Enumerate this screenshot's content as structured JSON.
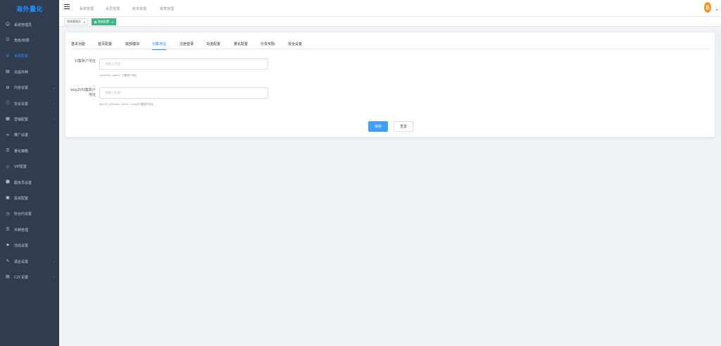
{
  "brand": {
    "title": "海外量化"
  },
  "sidebar": {
    "items": [
      {
        "label": "系统管理员",
        "icon": "user-icon",
        "glyph": "☺",
        "active": false,
        "has_arrow": false
      },
      {
        "label": "角色/权限",
        "icon": "org-chart-icon",
        "glyph": "☷",
        "active": false,
        "has_arrow": false
      },
      {
        "label": "系统配置",
        "icon": "gear-icon",
        "glyph": "⚙",
        "active": true,
        "has_arrow": false
      },
      {
        "label": "充提币种",
        "icon": "briefcase-icon",
        "glyph": "▤",
        "active": false,
        "has_arrow": false
      },
      {
        "label": "内容设置",
        "icon": "cog-icon",
        "glyph": "⚙",
        "active": false,
        "has_arrow": true
      },
      {
        "label": "协议设置",
        "icon": "info-circle-icon",
        "glyph": "ⓘ",
        "active": false,
        "has_arrow": true
      },
      {
        "label": "营销配置",
        "icon": "calendar-icon",
        "glyph": "▦",
        "active": false,
        "has_arrow": true
      },
      {
        "label": "推广设置",
        "icon": "link-icon",
        "glyph": "∞",
        "active": false,
        "has_arrow": false
      },
      {
        "label": "量化策略",
        "icon": "database-icon",
        "glyph": "☰",
        "active": false,
        "has_arrow": false
      },
      {
        "label": "VIP配置",
        "icon": "shield-icon",
        "glyph": "◇",
        "active": false,
        "has_arrow": false
      },
      {
        "label": "跟单员设置",
        "icon": "person-icon",
        "glyph": "☻",
        "active": false,
        "has_arrow": false
      },
      {
        "label": "投资配置",
        "icon": "picture-icon",
        "glyph": "▣",
        "active": false,
        "has_arrow": false
      },
      {
        "label": "秒合约设置",
        "icon": "clock-icon",
        "glyph": "◷",
        "active": false,
        "has_arrow": false
      },
      {
        "label": "币种管理",
        "icon": "stack-icon",
        "glyph": "☰",
        "active": false,
        "has_arrow": false
      },
      {
        "label": "活动设置",
        "icon": "flag-icon",
        "glyph": "⚑",
        "active": false,
        "has_arrow": false
      },
      {
        "label": "语言设置",
        "icon": "edit-icon",
        "glyph": "✎",
        "active": false,
        "has_arrow": true
      },
      {
        "label": "C2C设置",
        "icon": "wallet-icon",
        "glyph": "▤",
        "active": false,
        "has_arrow": true
      }
    ]
  },
  "header": {
    "tabs": [
      {
        "label": "系统管理",
        "active": true
      },
      {
        "label": "会员管理",
        "active": false
      },
      {
        "label": "账单管理",
        "active": false
      },
      {
        "label": "报表管理",
        "active": false
      }
    ],
    "avatar_glyph": "₿",
    "avatar_caret": "▾"
  },
  "tagsbar": {
    "tags": [
      {
        "label": "系统管理员",
        "close": "×",
        "active": false
      },
      {
        "label": "系统配置",
        "close": "×",
        "active": true
      }
    ]
  },
  "settings": {
    "tabs": [
      {
        "label": "基本功能",
        "active": false
      },
      {
        "label": "首页配置",
        "active": false
      },
      {
        "label": "底部模块",
        "active": false
      },
      {
        "label": "归集地址",
        "active": true
      },
      {
        "label": "注册登录",
        "active": false
      },
      {
        "label": "充值配置",
        "active": false
      },
      {
        "label": "量化配置",
        "active": false
      },
      {
        "label": "分享奖励",
        "active": false
      },
      {
        "label": "安全设置",
        "active": false
      }
    ],
    "fields": [
      {
        "label": "归集账户地址",
        "placeholder": "请输入内容",
        "value": "",
        "hint": "collection_wallet : 归集账户地址"
      },
      {
        "label": "bep20归集账户地址",
        "placeholder": "请输入内容",
        "value": "",
        "hint": "bep20_collection_wallet : bep20归集账户地址"
      }
    ],
    "save_label": "保存",
    "reset_label": "重置"
  },
  "colors": {
    "accent": "#1f8ffd",
    "sidebar_bg": "#2f3d4f",
    "tag_active": "#42b983",
    "primary_button": "#409eff"
  }
}
